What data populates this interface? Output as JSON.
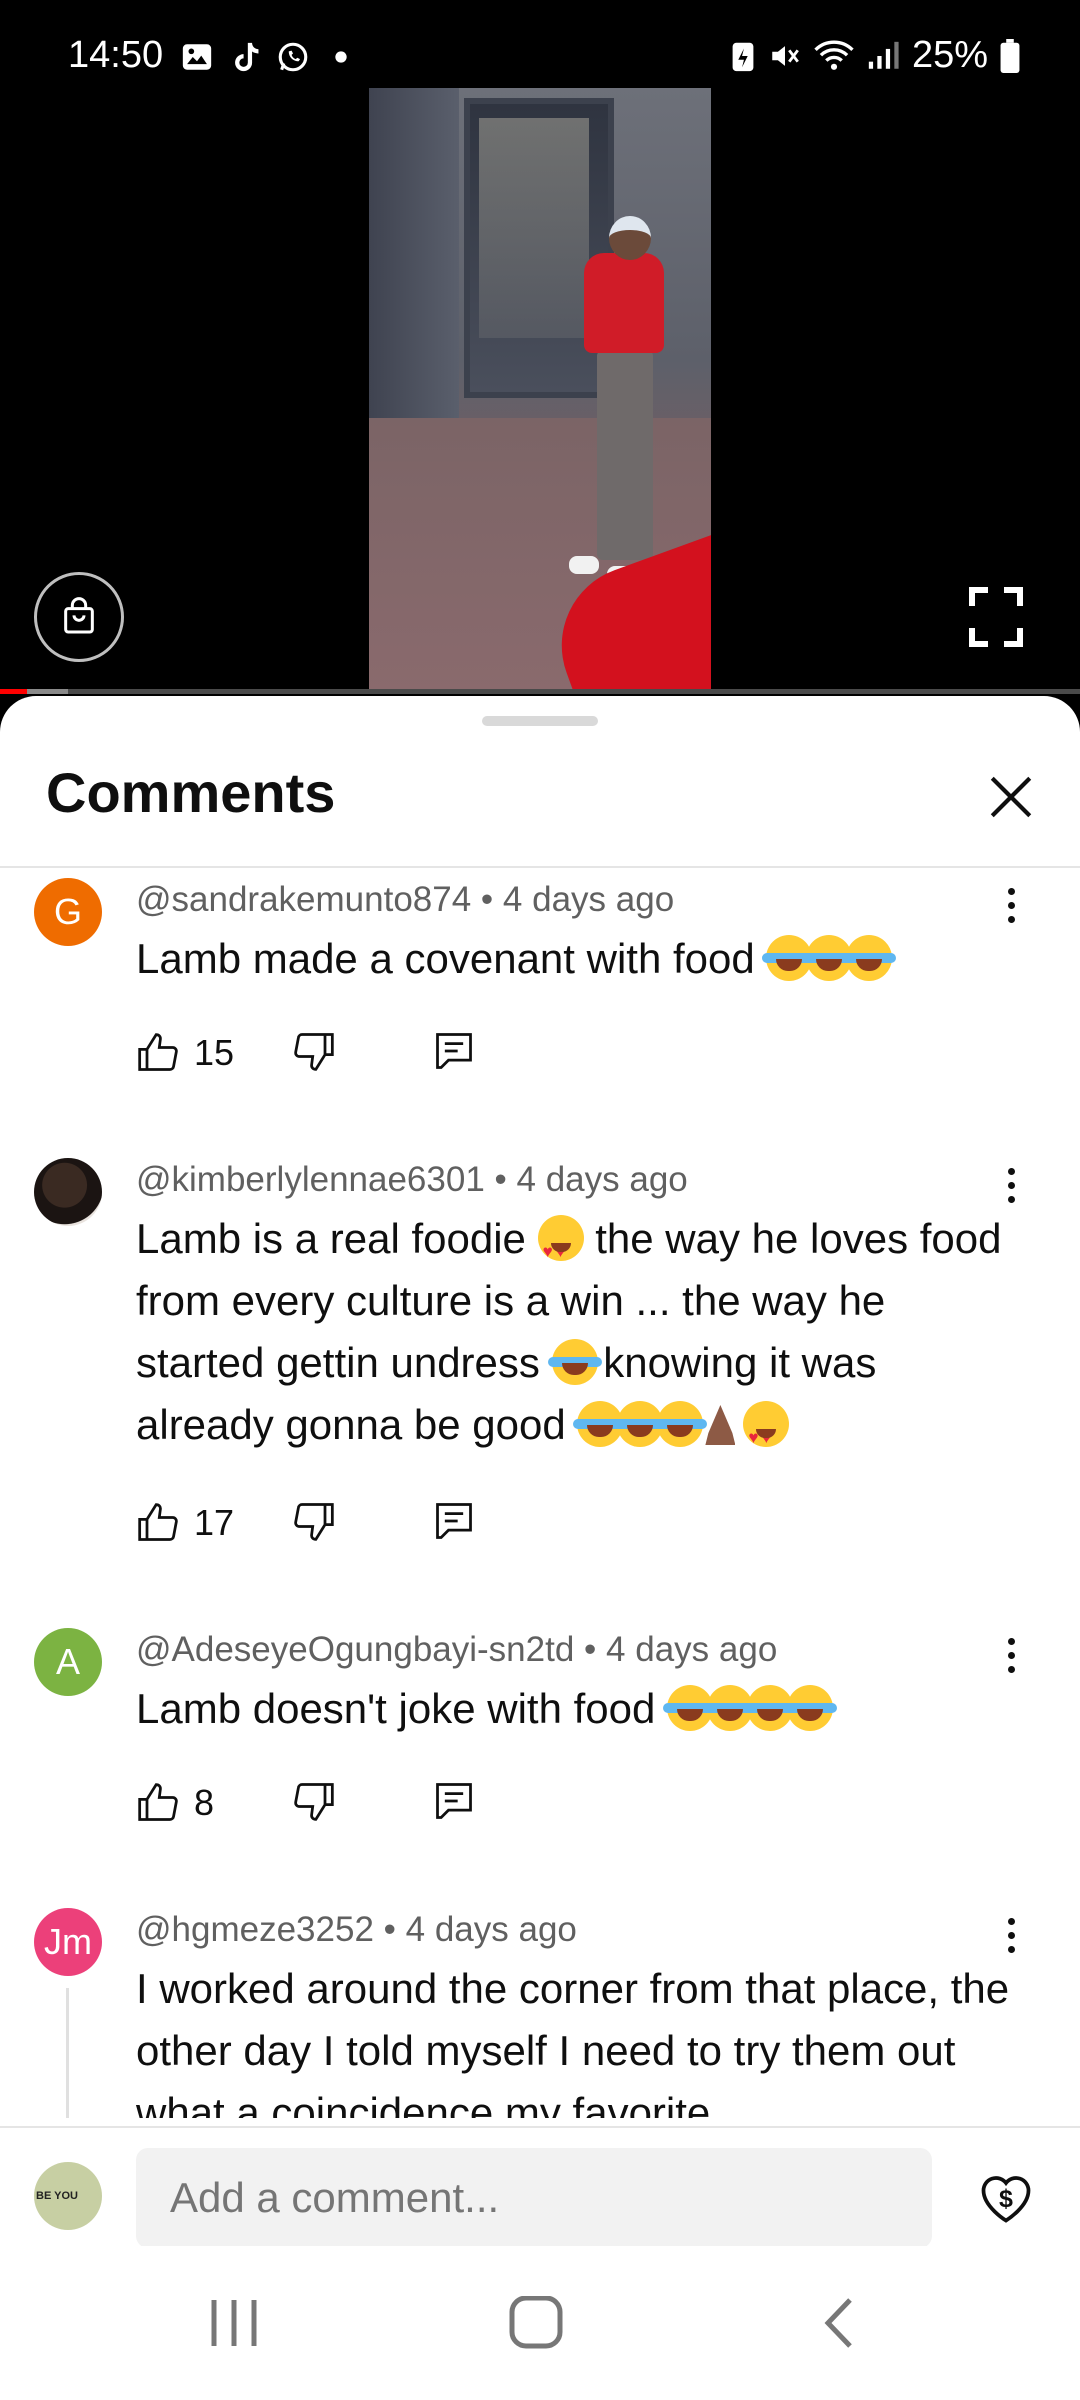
{
  "status_bar": {
    "time": "14:50",
    "battery": "25%",
    "left_icons": [
      "gallery-icon",
      "tiktok-icon",
      "whatsapp-icon",
      "dot-icon"
    ],
    "right_icons": [
      "battery-saver-icon",
      "mute-icon",
      "wifi-icon",
      "signal-icon",
      "battery-icon"
    ]
  },
  "video": {
    "progress_fraction": 0.025,
    "buffered_fraction": 0.063,
    "accent_color": "#ff0000"
  },
  "comments_panel": {
    "title": "Comments",
    "comments": [
      {
        "avatar_letter": "G",
        "avatar_color": "#ef6c00",
        "author": "@sandrakemunto874",
        "time": "4 days ago",
        "text": "Lamb made a covenant with food",
        "emojis": [
          "lol",
          "lol",
          "lol"
        ],
        "likes": "15"
      },
      {
        "avatar_letter": "",
        "avatar_color": "#2b201c",
        "author": "@kimberlylennae6301",
        "time": "4 days ago",
        "text_parts": [
          "Lamb is a real foodie ",
          " the way he loves food from every culture is a win ... the way he started gettin undress ",
          " knowing it was already gonna be good "
        ],
        "likes": "17"
      },
      {
        "avatar_letter": "A",
        "avatar_color": "#7cb342",
        "author": "@AdeseyeOgungbayi-sn2td",
        "time": "4 days ago",
        "text": "Lamb doesn't joke with food",
        "emojis": [
          "lol",
          "lol",
          "lol",
          "lol"
        ],
        "likes": "8"
      },
      {
        "avatar_letter": "Jm",
        "avatar_color": "#ec407a",
        "author": "@hgmeze3252",
        "time": "4 days ago",
        "text": "I worked around the corner from that place, the other day I told myself I need to try them out what a coincidence my favorite"
      }
    ]
  },
  "input_bar": {
    "placeholder": "Add a comment...",
    "avatar_text": "BE YOU"
  },
  "meta_separator": "•"
}
